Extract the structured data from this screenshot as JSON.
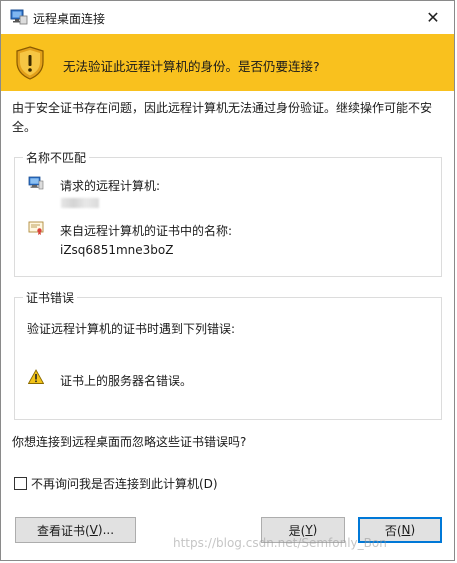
{
  "window": {
    "title": "远程桌面连接",
    "close_glyph": "✕"
  },
  "banner": {
    "text": "无法验证此远程计算机的身份。是否仍要连接?"
  },
  "description": "由于安全证书存在问题，因此远程计算机无法通过身份验证。继续操作可能不安全。",
  "group_name_mismatch": {
    "title": "名称不匹配",
    "requested_label": "请求的远程计算机:",
    "cert_name_label": "来自远程计算机的证书中的名称:",
    "cert_name_value": "iZsq6851mne3boZ"
  },
  "group_cert_errors": {
    "title": "证书错误",
    "intro": "验证远程计算机的证书时遇到下列错误:",
    "error_item": "证书上的服务器名错误。"
  },
  "question": "你想连接到远程桌面而忽略这些证书错误吗?",
  "checkbox": {
    "label": "不再询问我是否连接到此计算机(D)",
    "checked": false
  },
  "buttons": {
    "view_cert_pre": "查看证书(",
    "view_cert_key": "V",
    "view_cert_post": ")...",
    "yes_pre": "是(",
    "yes_key": "Y",
    "yes_post": ")",
    "no_pre": "否(",
    "no_key": "N",
    "no_post": ")"
  },
  "watermark": "https://blog.csdn.net/Semfonly_Bon",
  "colors": {
    "banner": "#f9c11e",
    "button_bg": "#e1e1e1",
    "focus_border": "#0078d7"
  }
}
